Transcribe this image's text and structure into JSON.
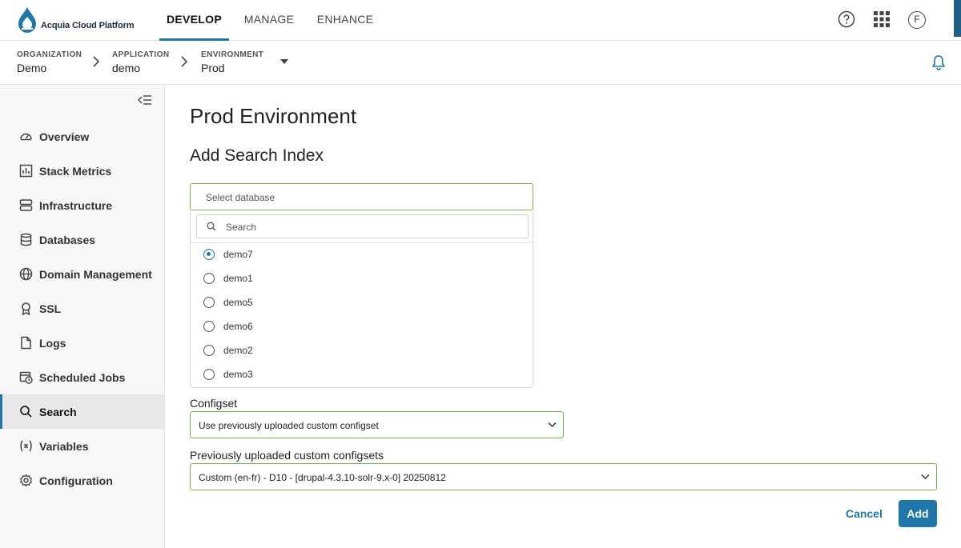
{
  "header": {
    "brand": "Acquia Cloud Platform",
    "tabs": [
      {
        "label": "DEVELOP",
        "active": true
      },
      {
        "label": "MANAGE",
        "active": false
      },
      {
        "label": "ENHANCE",
        "active": false
      }
    ],
    "icons": [
      "help-icon",
      "app-grid-icon",
      "user-avatar"
    ],
    "avatar_initial": "F",
    "accent_color": "#1f76a8"
  },
  "breadcrumb": [
    {
      "label": "ORGANIZATION",
      "value": "Demo"
    },
    {
      "label": "APPLICATION",
      "value": "demo"
    },
    {
      "label": "ENVIRONMENT",
      "value": "Prod"
    }
  ],
  "sidebar": {
    "items": [
      {
        "label": "Overview",
        "icon": "gauge-icon",
        "active": false
      },
      {
        "label": "Stack Metrics",
        "icon": "chart-icon",
        "active": false
      },
      {
        "label": "Infrastructure",
        "icon": "server-icon",
        "active": false
      },
      {
        "label": "Databases",
        "icon": "database-icon",
        "active": false
      },
      {
        "label": "Domain Management",
        "icon": "globe-icon",
        "active": false
      },
      {
        "label": "SSL",
        "icon": "certificate-icon",
        "active": false
      },
      {
        "label": "Logs",
        "icon": "file-icon",
        "active": false
      },
      {
        "label": "Scheduled Jobs",
        "icon": "calendar-clock-icon",
        "active": false
      },
      {
        "label": "Search",
        "icon": "search-icon",
        "active": true
      },
      {
        "label": "Variables",
        "icon": "variable-icon",
        "active": false
      },
      {
        "label": "Configuration",
        "icon": "gear-icon",
        "active": false
      }
    ]
  },
  "main": {
    "page_title": "Prod Environment",
    "section_title": "Add Search Index",
    "database_select": {
      "placeholder": "Select database",
      "search_placeholder": "Search",
      "options": [
        {
          "label": "demo7",
          "selected": true
        },
        {
          "label": "demo1",
          "selected": false
        },
        {
          "label": "demo5",
          "selected": false
        },
        {
          "label": "demo6",
          "selected": false
        },
        {
          "label": "demo2",
          "selected": false
        },
        {
          "label": "demo3",
          "selected": false
        }
      ]
    },
    "configset": {
      "label": "Configset",
      "value": "Use previously uploaded custom configset"
    },
    "custom_configsets": {
      "label": "Previously uploaded custom configsets",
      "value": "Custom (en-fr) - D10 - [drupal-4.3.10-solr-9.x-0] 20250812"
    },
    "buttons": {
      "cancel": "Cancel",
      "add": "Add"
    }
  }
}
